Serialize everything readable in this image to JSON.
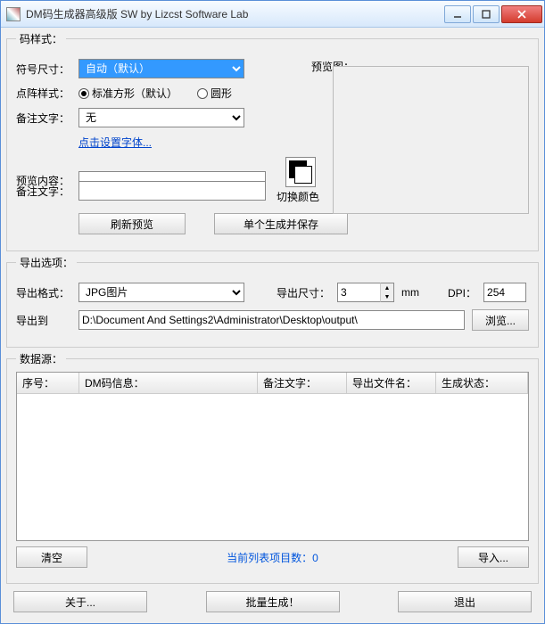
{
  "window": {
    "title": "DM码生成器高级版 SW  by Lizcst Software Lab"
  },
  "groups": {
    "style": "码样式：",
    "export": "导出选项：",
    "datasource": "数据源："
  },
  "style": {
    "symbol_size_label": "符号尺寸：",
    "symbol_size_value": "自动（默认）",
    "preview_img_label": "预览图：",
    "dot_style_label": "点阵样式：",
    "radio_square": "标准方形（默认）",
    "radio_circle": "圆形",
    "remark_label": "备注文字：",
    "remark_value": "无",
    "font_link": "点击设置字体...",
    "preview_content_label": "预览内容：",
    "preview_content_value": "",
    "remark_text_label": "备注文字：",
    "remark_text_value": "",
    "swap_color_label": "切换颜色",
    "refresh_btn": "刷新预览",
    "single_gen_btn": "单个生成并保存"
  },
  "export": {
    "format_label": "导出格式：",
    "format_value": "JPG图片",
    "size_label": "导出尺寸：",
    "size_value": "3",
    "size_unit": "mm",
    "dpi_label": "DPI：",
    "dpi_value": "254",
    "path_label": "导出到",
    "path_value": "D:\\Document And Settings2\\Administrator\\Desktop\\output\\",
    "browse_btn": "浏览..."
  },
  "datasource": {
    "columns": {
      "index": "序号：",
      "dm_info": "DM码信息：",
      "remark": "备注文字：",
      "filename": "导出文件名：",
      "status": "生成状态："
    },
    "clear_btn": "清空",
    "count_label": "当前列表项目数：",
    "count_value": "0",
    "import_btn": "导入..."
  },
  "bottom": {
    "about_btn": "关于...",
    "batch_btn": "批量生成！",
    "exit_btn": "退出"
  }
}
